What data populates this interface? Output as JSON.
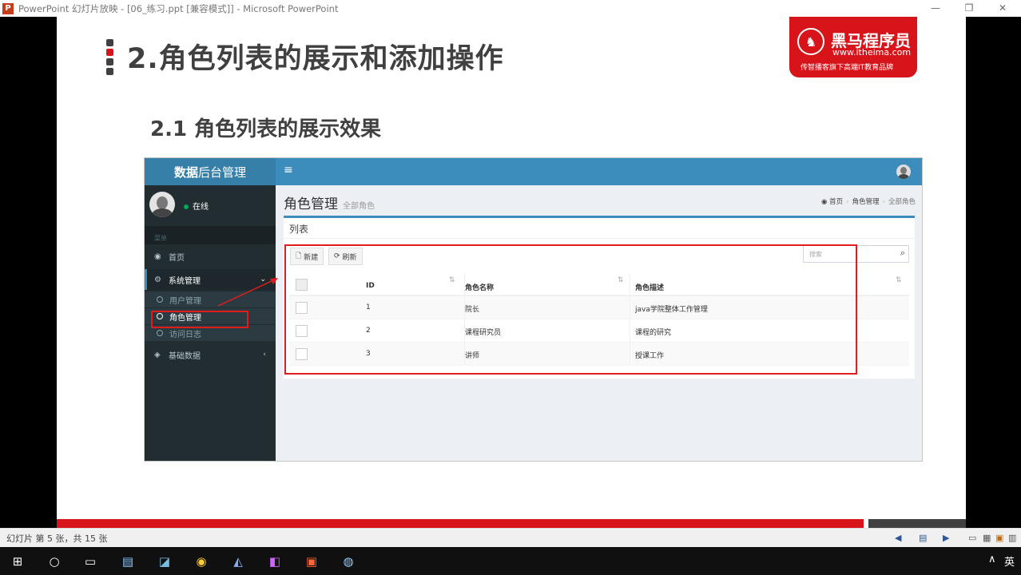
{
  "window": {
    "title": "PowerPoint 幻灯片放映 - [06_练习.ppt [兼容模式]] - Microsoft PowerPoint",
    "icon_label": "P",
    "minimize": "—",
    "restore": "❐",
    "close": "✕"
  },
  "slide": {
    "title": "2.角色列表的展示和添加操作",
    "subtitle": "2.1 角色列表的展示效果",
    "bullet_colors": [
      "#404040",
      "#d7141a",
      "#404040",
      "#404040"
    ],
    "logo": {
      "name": "黑马程序员",
      "url": "www.itheima.com",
      "slogan": "传智播客旗下高端IT教育品牌",
      "color": "#d7141a"
    }
  },
  "app": {
    "brand_bold": "数据",
    "brand_rest": "后台管理",
    "toggle_icon": "≡",
    "user": {
      "status": "在线"
    },
    "menu_header": "菜单",
    "menu": [
      {
        "icon": "dashboard-icon",
        "label": "首页"
      },
      {
        "icon": "gears-icon",
        "label": "系统管理",
        "caret": "⌄"
      },
      {
        "icon": "cube-icon",
        "label": "基础数据",
        "caret": "‹"
      }
    ],
    "submenu": [
      {
        "label": "用户管理"
      },
      {
        "label": "角色管理"
      },
      {
        "label": "访问日志"
      }
    ],
    "page": {
      "header": "角色管理",
      "subheader": "全部角色",
      "breadcrumb": [
        "首页",
        "角色管理",
        "全部角色"
      ]
    },
    "box_title": "列表",
    "buttons": {
      "new": "新建",
      "refresh": "刷新"
    },
    "search": {
      "placeholder": "搜索"
    },
    "table": {
      "columns": [
        "ID",
        "角色名称",
        "角色描述"
      ],
      "rows": [
        {
          "id": "1",
          "name": "院长",
          "desc": "java学院整体工作管理"
        },
        {
          "id": "2",
          "name": "课程研究员",
          "desc": "课程的研究"
        },
        {
          "id": "3",
          "name": "讲师",
          "desc": "授课工作"
        }
      ]
    }
  },
  "statusbar": {
    "text": "幻灯片 第 5 张，共 15 张"
  },
  "taskbar": {
    "ime": "英",
    "tray_up": "∧"
  }
}
